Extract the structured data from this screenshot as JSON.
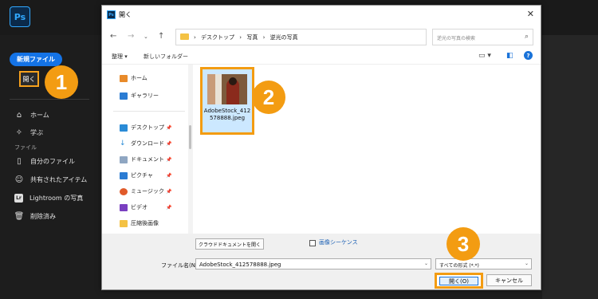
{
  "app": {
    "logo": "Ps",
    "new_file_label": "新規ファイル",
    "open_label": "開く",
    "nav": {
      "home": "ホーム",
      "learn": "学ぶ",
      "files_section": "ファイル",
      "your_files": "自分のファイル",
      "shared": "共有されたアイテム",
      "lightroom": "Lightroom の写真",
      "lr_icon": "Lr",
      "deleted": "削除済み"
    }
  },
  "dialog": {
    "title": "開く",
    "breadcrumbs": [
      "デスクトップ",
      "写真",
      "逆光の写真"
    ],
    "search_placeholder": "逆光の写真の検索",
    "toolbar": {
      "organize": "整理 ▾",
      "new_folder": "新しいフォルダー"
    },
    "nav_pane": {
      "quick": [
        "ホーム",
        "ギャラリー"
      ],
      "pinned": [
        "デスクトップ",
        "ダウンロード",
        "ドキュメント",
        "ピクチャ",
        "ミュージック",
        "ビデオ"
      ],
      "other": [
        "圧縮後画像"
      ]
    },
    "file": {
      "name": "AdobeStock_412578888.jpeg"
    },
    "cloud_button": "クラウドドキュメントを開く",
    "sequence_label": "画像シーケンス",
    "filename_label": "ファイル名(N):",
    "filename_value": "AdobeStock_412578888.jpeg",
    "filetype_value": "すべての形式 (*.*)",
    "open_button": "開く(O)",
    "cancel_button": "キャンセル"
  },
  "steps": [
    "1",
    "2",
    "3"
  ],
  "colors": {
    "highlight": "#f39c12",
    "accent_blue": "#1473e6",
    "ps_blue": "#31a8ff"
  }
}
